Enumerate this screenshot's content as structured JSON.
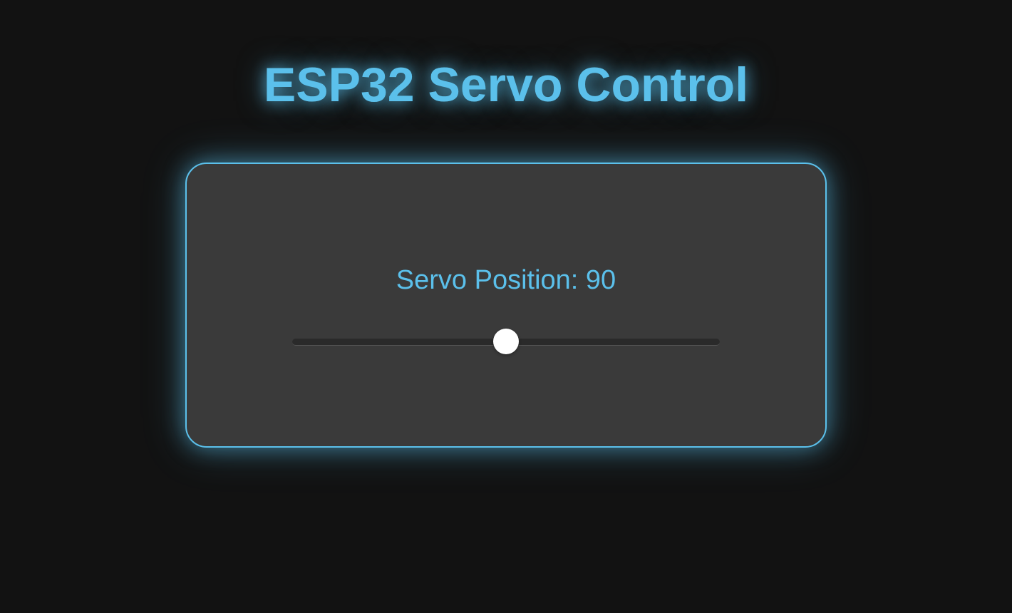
{
  "title": "ESP32 Servo Control",
  "servo": {
    "label_prefix": "Servo Position: ",
    "position": "90",
    "min": "0",
    "max": "180"
  }
}
